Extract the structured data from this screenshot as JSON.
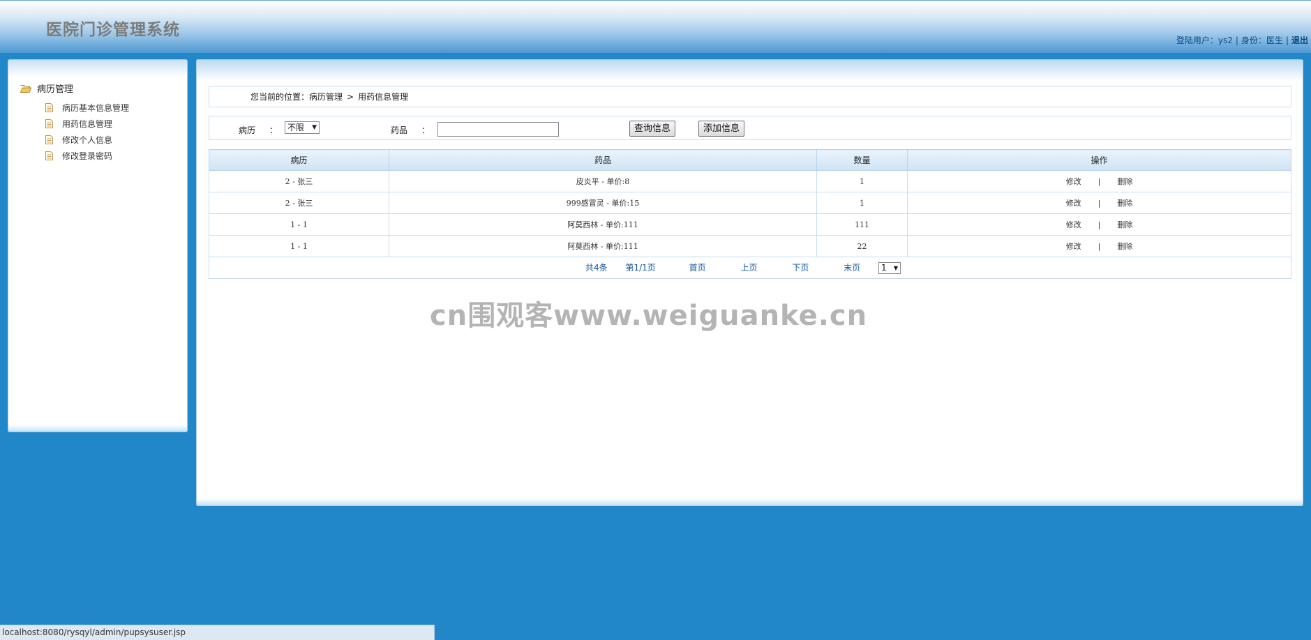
{
  "header": {
    "app_title": "医院门诊管理系统",
    "login_user_label": "登陆用户：",
    "login_user": "ys2",
    "role_label": "身份：",
    "role": "医生",
    "logout_label": "退出"
  },
  "sidebar": {
    "root_label": "病历管理",
    "items": [
      {
        "label": "病历基本信息管理"
      },
      {
        "label": "用药信息管理"
      },
      {
        "label": "修改个人信息"
      },
      {
        "label": "修改登录密码"
      }
    ]
  },
  "breadcrumb": {
    "prefix": "您当前的位置：",
    "level1": "病历管理",
    "separator": ">",
    "level2": "用药信息管理"
  },
  "filter": {
    "record_label": "病历",
    "record_value": "不限",
    "drug_label": "药品",
    "drug_value": "",
    "colon": "：",
    "query_button": "查询信息",
    "add_button": "添加信息"
  },
  "table": {
    "headers": [
      "病历",
      "药品",
      "数量",
      "操作"
    ],
    "rows": [
      {
        "record": "2 - 张三",
        "drug": "皮炎平 - 单价:8",
        "qty": "1"
      },
      {
        "record": "2 - 张三",
        "drug": "999感冒灵 - 单价:15",
        "qty": "1"
      },
      {
        "record": "1 - 1",
        "drug": "阿莫西林 - 单价:111",
        "qty": "111"
      },
      {
        "record": "1 - 1",
        "drug": "阿莫西林 - 单价:111",
        "qty": "22"
      }
    ],
    "edit_label": "修改",
    "op_separator": "|",
    "delete_label": "删除"
  },
  "pager": {
    "total": "共4条",
    "page_info": "第1/1页",
    "first": "首页",
    "prev": "上页",
    "next": "下页",
    "last": "末页",
    "current_page": "1"
  },
  "watermark": "cn围观客www.weiguanke.cn",
  "statusbar": {
    "url": "localhost:8080/rysqyl/admin/pupsysuser.jsp"
  }
}
